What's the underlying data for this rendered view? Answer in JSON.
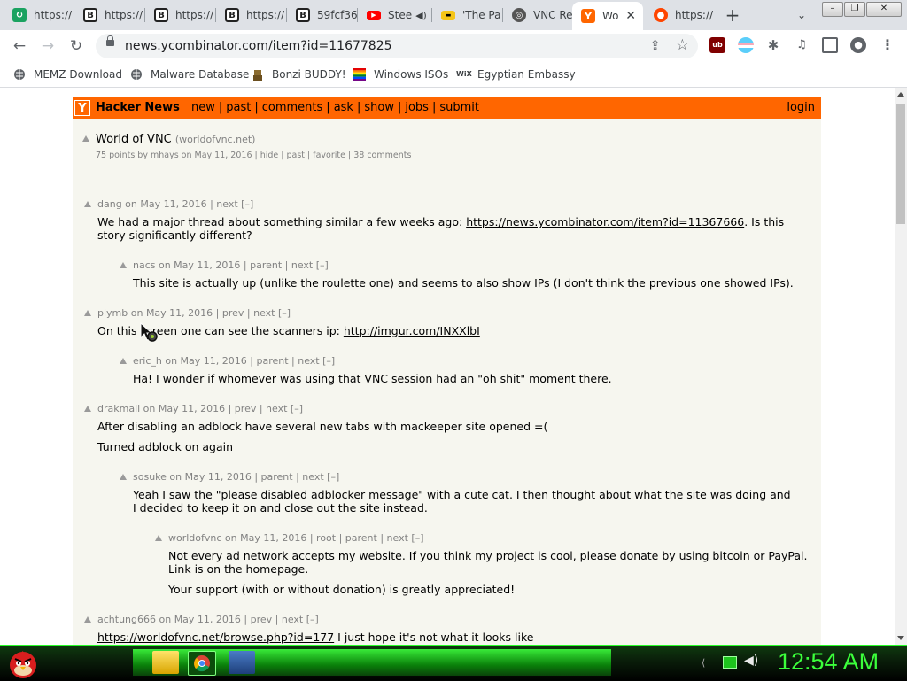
{
  "tabs": [
    {
      "title": "https://",
      "favicon": "app-icon",
      "color": "#1aa260"
    },
    {
      "title": "https://",
      "favicon": "b-icon",
      "color": "#222222"
    },
    {
      "title": "https://",
      "favicon": "b-icon",
      "color": "#222222"
    },
    {
      "title": "https://",
      "favicon": "b-icon",
      "color": "#222222"
    },
    {
      "title": "59fcf36",
      "favicon": "b-icon",
      "color": "#222222"
    },
    {
      "title": "Stee",
      "favicon": "youtube-icon",
      "color": "#ff0000"
    },
    {
      "title": "'The Pa",
      "favicon": "imdb-icon",
      "color": "#f5c518"
    },
    {
      "title": "VNC Re",
      "favicon": "vnc-icon",
      "color": "#555555"
    },
    {
      "title": "Wo",
      "favicon": "hn-icon",
      "color": "#ff6600"
    },
    {
      "title": "https://",
      "favicon": "reddit-icon",
      "color": "#ff4500"
    }
  ],
  "browser": {
    "url": "news.ycombinator.com/item?id=11677825",
    "new_tab": "+",
    "tab_search": "⌄"
  },
  "bookmarks": [
    {
      "label": "MEMZ Download",
      "icon": "globe-icon"
    },
    {
      "label": "Malware Database",
      "icon": "globe-icon"
    },
    {
      "label": "Bonzi BUDDY!",
      "icon": "bonzi-icon"
    },
    {
      "label": "Windows ISOs",
      "icon": "windows-icon"
    },
    {
      "label": "Egyptian Embassy",
      "icon": "wix-icon"
    }
  ],
  "hn": {
    "logo": "Y",
    "site_name": "Hacker News",
    "nav": [
      "new",
      "past",
      "comments",
      "ask",
      "show",
      "jobs",
      "submit"
    ],
    "login": "login",
    "story": {
      "title": "World of VNC",
      "domain": "(worldofvnc.net)",
      "subtext": "75 points by mhays on May 11, 2016 | hide | past | favorite | 38 comments"
    },
    "comments": [
      {
        "head": "dang on May 11, 2016 | next [–]",
        "text": "We had a major thread about something similar a few weeks ago: ",
        "link": "https://news.ycombinator.com/item?id=11367666",
        "text_after": ". Is this story significantly different?"
      },
      {
        "head": "nacs on May 11, 2016 | parent | next [–]",
        "text": "This site is actually up (unlike the roulette one) and seems to also show IPs (I don't think the previous one showed IPs)."
      },
      {
        "head": "plymb on May 11, 2016 | prev | next [–]",
        "text": "On this screen one can see the scanners ip: ",
        "link": "http://imgur.com/INXXlbI"
      },
      {
        "head": "eric_h on May 11, 2016 | parent | next [–]",
        "text": "Ha! I wonder if whomever was using that VNC session had an \"oh shit\" moment there."
      },
      {
        "head": "drakmail on May 11, 2016 | prev | next [–]",
        "text": "After disabling an adblock have several new tabs with mackeeper site opened =(",
        "text2": "Turned adblock on again"
      },
      {
        "head": "sosuke on May 11, 2016 | parent | next [–]",
        "text": "Yeah I saw the \"please disabled adblocker message\" with a cute cat. I then thought about what the site was doing and I decided to keep it on and close out the site instead."
      },
      {
        "head": "worldofvnc on May 11, 2016 | root | parent | next [–]",
        "text": "Not every ad network accepts my website. If you think my project is cool, please donate by using bitcoin or PayPal. Link is on the homepage.",
        "text2": "Your support (with or without donation) is greatly appreciated!"
      },
      {
        "head": "achtung666 on May 11, 2016 | prev | next [–]",
        "link": "https://worldofvnc.net/browse.php?id=177",
        "text_after": " I just hope it's not what it looks like"
      }
    ]
  },
  "taskbar": {
    "clock": "12:54 AM"
  }
}
